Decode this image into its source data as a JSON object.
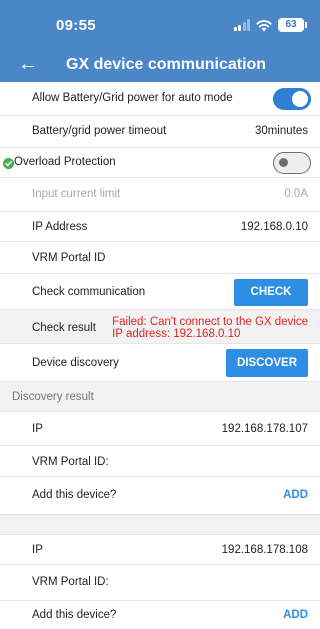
{
  "status": {
    "time": "09:55",
    "battery": "63"
  },
  "header": {
    "title": "GX device communication"
  },
  "settings": {
    "auto_mode": {
      "label": "Allow Battery/Grid power for auto mode",
      "enabled": true
    },
    "timeout": {
      "label": "Battery/grid power timeout",
      "value": "30minutes"
    },
    "overload": {
      "label": "Overload Protection",
      "enabled": false
    },
    "input_limit": {
      "label": "Input current limit",
      "value": "0.0A"
    },
    "ip_address": {
      "label": "IP Address",
      "value": "192.168.0.10"
    },
    "vrm_portal": {
      "label": "VRM Portal ID",
      "value": ""
    },
    "check_comm": {
      "label": "Check communication",
      "button": "CHECK"
    },
    "check_result": {
      "label": "Check result",
      "line1": "Failed: Can't connect to the GX device",
      "line2": "IP address: 192.168.0.10"
    },
    "discovery": {
      "label": "Device discovery",
      "button": "DISCOVER"
    }
  },
  "discovery_result": {
    "header": "Discovery result",
    "devices": [
      {
        "ip_label": "IP",
        "ip": "192.168.178.107",
        "vrm_label": "VRM Portal ID:",
        "add_label": "Add this device?",
        "add_button": "ADD"
      },
      {
        "ip_label": "IP",
        "ip": "192.168.178.108",
        "vrm_label": "VRM Portal ID:",
        "add_label": "Add this device?",
        "add_button": "ADD"
      }
    ]
  },
  "colors": {
    "header_bg": "#4a86c8",
    "accent": "#2d8ee3",
    "error": "#e02424",
    "check_green": "#4caf50"
  }
}
